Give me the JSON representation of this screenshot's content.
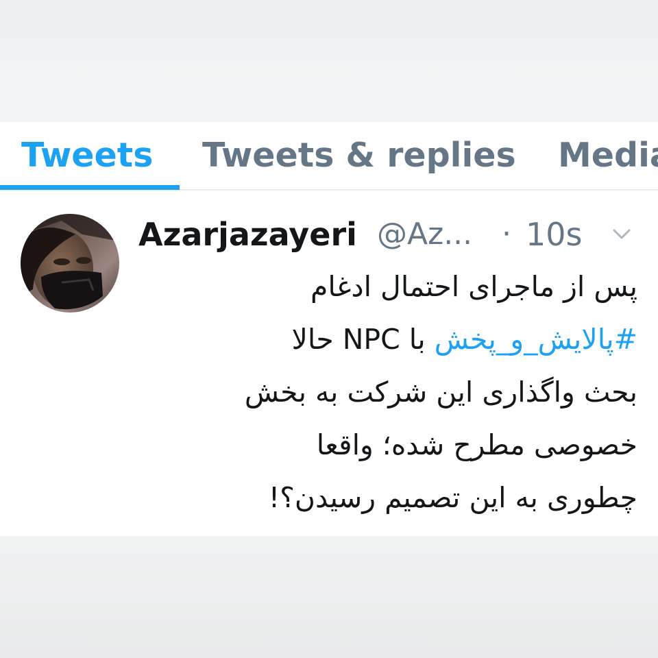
{
  "tabs": {
    "tweets": "Tweets",
    "replies": "Tweets & replies",
    "media": "Media"
  },
  "tweet": {
    "name": "Azarjazayeri",
    "handle": "@Az...",
    "separator": "·",
    "time": "10s",
    "lines": {
      "l1": "پس از ماجرای احتمال ادغام",
      "l2_hashtag": "#پالایش_و_پخش",
      "l2_rest": " با NPC حالا",
      "l3": "بحث واگذاری این شرکت به بخش",
      "l4": "خصوصی مطرح شده؛ واقعا",
      "l5": "چطوری به این تصمیم رسیدن؟!"
    }
  },
  "icons": {
    "caret": "chevron-down-icon"
  },
  "colors": {
    "accent": "#1da1f2",
    "text": "#14171a",
    "muted": "#657786"
  }
}
